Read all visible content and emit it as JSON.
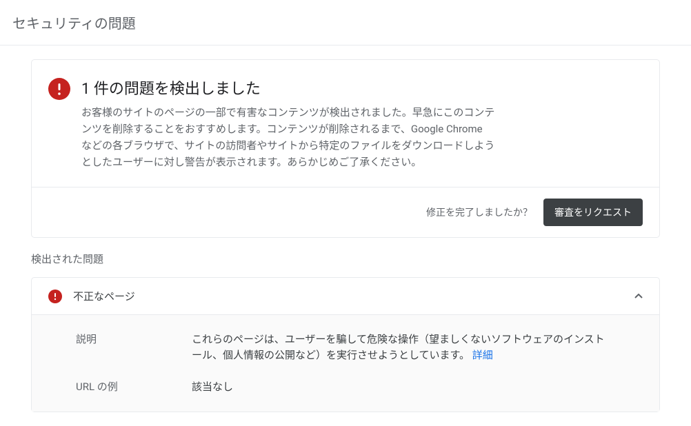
{
  "header": {
    "title": "セキュリティの問題"
  },
  "alert": {
    "title": "1 件の問題を検出しました",
    "description": "お客様のサイトのページの一部で有害なコンテンツが検出されました。早急にこのコンテンツを削除することをおすすめします。コンテンツが削除されるまで、Google Chrome などの各ブラウザで、サイトの訪問者やサイトから特定のファイルをダウンロードしようとしたユーザーに対し警告が表示されます。あらかじめご了承ください。"
  },
  "action": {
    "prompt": "修正を完了しましたか？",
    "button": "審査をリクエスト"
  },
  "section": {
    "title": "検出された問題"
  },
  "issue": {
    "title": "不正なページ",
    "details": {
      "desc_label": "説明",
      "desc_value": "これらのページは、ユーザーを騙して危険な操作（望ましくないソフトウェアのインストール、個人情報の公開など）を実行させようとしています。",
      "desc_link": "詳細",
      "url_label": "URL の例",
      "url_value": "該当なし"
    }
  }
}
